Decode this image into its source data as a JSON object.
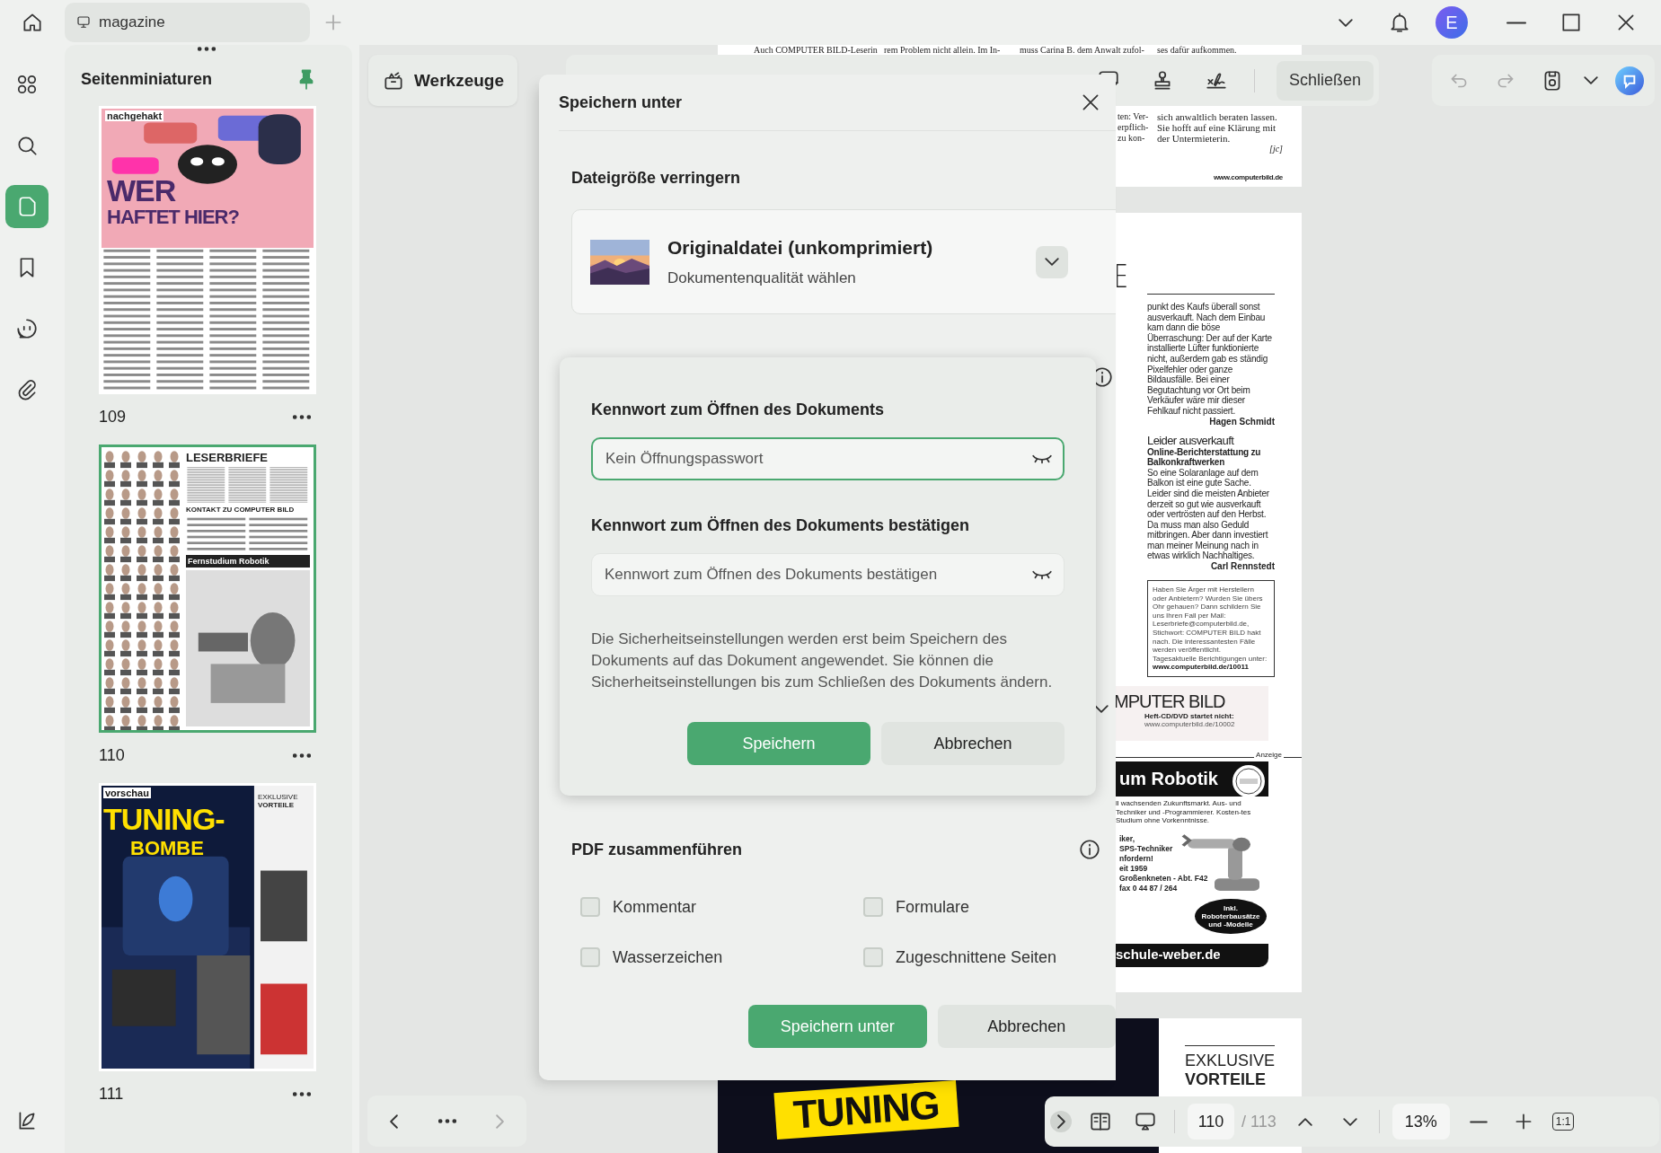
{
  "app_bar": {
    "tab_title": "magazine",
    "avatar": "E"
  },
  "rail": [
    {
      "kind": "apps",
      "selected": false
    },
    {
      "kind": "search",
      "selected": false
    },
    {
      "kind": "pages",
      "selected": true
    },
    {
      "kind": "bookmark",
      "selected": false
    },
    {
      "kind": "comment",
      "selected": false
    },
    {
      "kind": "attachment",
      "selected": false
    },
    {
      "kind": "reader",
      "selected": false
    }
  ],
  "thumbnails": {
    "title": "Seitenminiaturen",
    "pages": [
      {
        "kind": "article",
        "label": "109",
        "selected": false,
        "texts": [
          "nachgehakt",
          "WER",
          "HAFTET HIER?"
        ]
      },
      {
        "kind": "letters",
        "label": "110",
        "selected": true,
        "texts": [
          "LESERBRIEFE",
          "KONTAKT ZU COMPUTER BILD",
          "Fernstudium Robotik"
        ]
      },
      {
        "kind": "preview",
        "label": "111",
        "selected": false,
        "texts": [
          "vorschau",
          "TUNING-",
          "BOMBE",
          "EXKLUSIVE",
          "VORTEILE"
        ]
      }
    ]
  },
  "toolbar": {
    "tools": "Werkzeuge",
    "close": "Schließen"
  },
  "document": {
    "top_line": [
      "Auch COMPUTER BILD-Leserin",
      "rem Problem nicht allein. Im In-",
      "muss Carina B. dem Anwalt zufol-",
      "ses dafür aufkommen."
    ],
    "page_end": {
      "fragments": [
        "ten: Ver-",
        "erpflich-",
        "zu kon-"
      ],
      "text": "sich anwaltlich beraten lassen. Sie hofft auf eine Klärung mit der Untermieterin.",
      "sign": "[jc]",
      "url": "www.computerbild.de"
    },
    "letters": {
      "headline_fragment": "E",
      "body_1": "punkt des Kaufs überall sonst ausverkauft. Nach dem Einbau kam dann die böse Überraschung: Der auf der Karte installierte Lüfter funktionierte nicht, außerdem gab es ständig Pixelfehler oder ganze Bildausfälle. Bei einer Begutachtung vor Ort beim Verkäufer wäre mir dieser Fehlkauf nicht passiert.",
      "author_1": "Hagen Schmidt",
      "heading": "Leider ausverkauft",
      "subheading": "Online-Berichterstattung zu Balkonkraftwerken",
      "body_2": "So eine Solaranlage auf dem Balkon ist eine gute Sache. Leider sind die meisten Anbieter derzeit so gut wie ausverkauft oder vertrösten auf den Herbst. Da muss man also Geduld mitbringen. Aber dann investiert man meiner Meinung nach in etwas wirklich Nachhaltiges.",
      "author_2": "Carl Rennstedt",
      "notice": "Haben Sie Ärger mit Herstellern oder Anbietern? Wurden Sie übers Ohr gehauen? Dann schildern Sie uns Ihren Fall per Mail: Leserbriefe@computerbild.de, Stichwort: COMPUTER BILD hakt nach. Die interessantesten Fälle werden veröffentlicht.",
      "notice_2": "Tagesaktuelle Berichtigungen unter:",
      "notice_link": "www.computerbild.de/10011"
    },
    "cd_box": {
      "title": "MPUTER BILD",
      "text": "Heft-CD/DVD startet nicht:",
      "link": "www.computerbild.de/10002"
    },
    "ad": {
      "label": "Anzeige",
      "title": "um Robotik",
      "intro": "ll wachsenden Zukunftsmarkt. Aus- und Techniker und -Programmierer. Kosten-tes Studium ohne Vorkenntnisse.",
      "lines": [
        "iker,",
        "SPS-Techniker",
        "nfordern!",
        "eit 1959",
        "Großenkneten - Abt. F42",
        "fax 0 44 87 / 264"
      ],
      "badge": "Inkl. Roboterbausätze und -Modelle",
      "footer": "schule-weber.de"
    },
    "preview_page": {
      "banner": "TUNING",
      "side": [
        "EXKLUSIVE",
        "VORTEILE"
      ]
    }
  },
  "dialog": {
    "title": "Speichern unter",
    "section_1": "Dateigröße verringern",
    "option": {
      "title": "Originaldatei (unkomprimiert)",
      "subtitle": "Dokumentenqualität wählen"
    },
    "password": {
      "fields": [
        {
          "label": "Kennwort zum Öffnen des Dokuments",
          "placeholder": "Kein Öffnungspasswort",
          "focused": true
        },
        {
          "label": "Kennwort zum Öffnen des Dokuments bestätigen",
          "placeholder": "Kennwort zum Öffnen des Dokuments bestätigen",
          "focused": false
        }
      ],
      "note": "Die Sicherheitseinstellungen werden erst beim Speichern des Dokuments auf das Dokument angewendet. Sie können die Sicherheitseinstellungen bis zum Schließen des Dokuments ändern.",
      "buttons": [
        "Speichern",
        "Abbrechen"
      ]
    },
    "section_2": "PDF zusammenführen",
    "checkboxes": [
      {
        "label": "Kommentar",
        "checked": false
      },
      {
        "label": "Formulare",
        "checked": false
      },
      {
        "label": "Wasserzeichen",
        "checked": false
      },
      {
        "label": "Zugeschnittene Seiten",
        "checked": false
      }
    ],
    "buttons": [
      "Speichern unter",
      "Abbrechen"
    ]
  },
  "navigation": {
    "page": "110",
    "total": "/ 113",
    "zoom": "13%",
    "actual_size": "1:1"
  }
}
